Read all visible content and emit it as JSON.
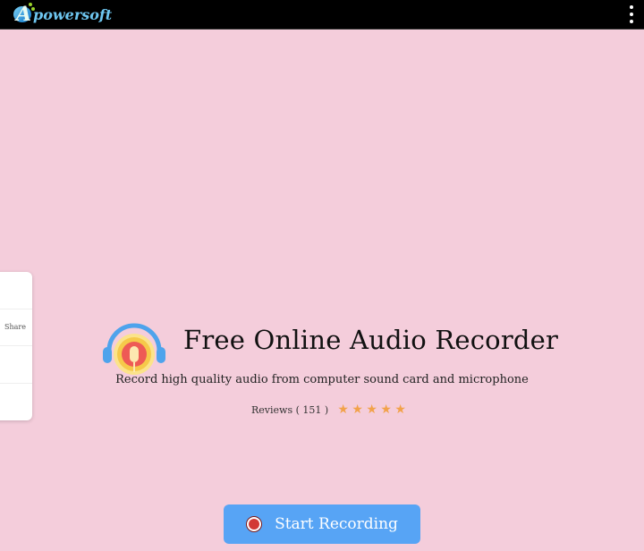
{
  "header": {
    "logo_letter": "A",
    "logo_text": "powersoft",
    "menu_icon": "more-vertical-icon"
  },
  "share_panel": {
    "items": [
      {
        "label": ""
      },
      {
        "label": "Share"
      },
      {
        "label": ""
      },
      {
        "label": ""
      }
    ]
  },
  "hero": {
    "icon": "headphone-microphone-icon",
    "title": "Free Online Audio Recorder",
    "subtitle": "Record high quality audio from computer sound card and microphone",
    "reviews_label": "Reviews ( 151 )",
    "reviews_count": 151,
    "rating": 5,
    "rating_max": 5
  },
  "actions": {
    "start_label": "Start Recording",
    "start_icon": "record-icon"
  },
  "colors": {
    "background": "#f4cddb",
    "topbar": "#000000",
    "accent_button": "#57a4f5",
    "star": "#f2a24a",
    "record_red": "#d23a35"
  }
}
